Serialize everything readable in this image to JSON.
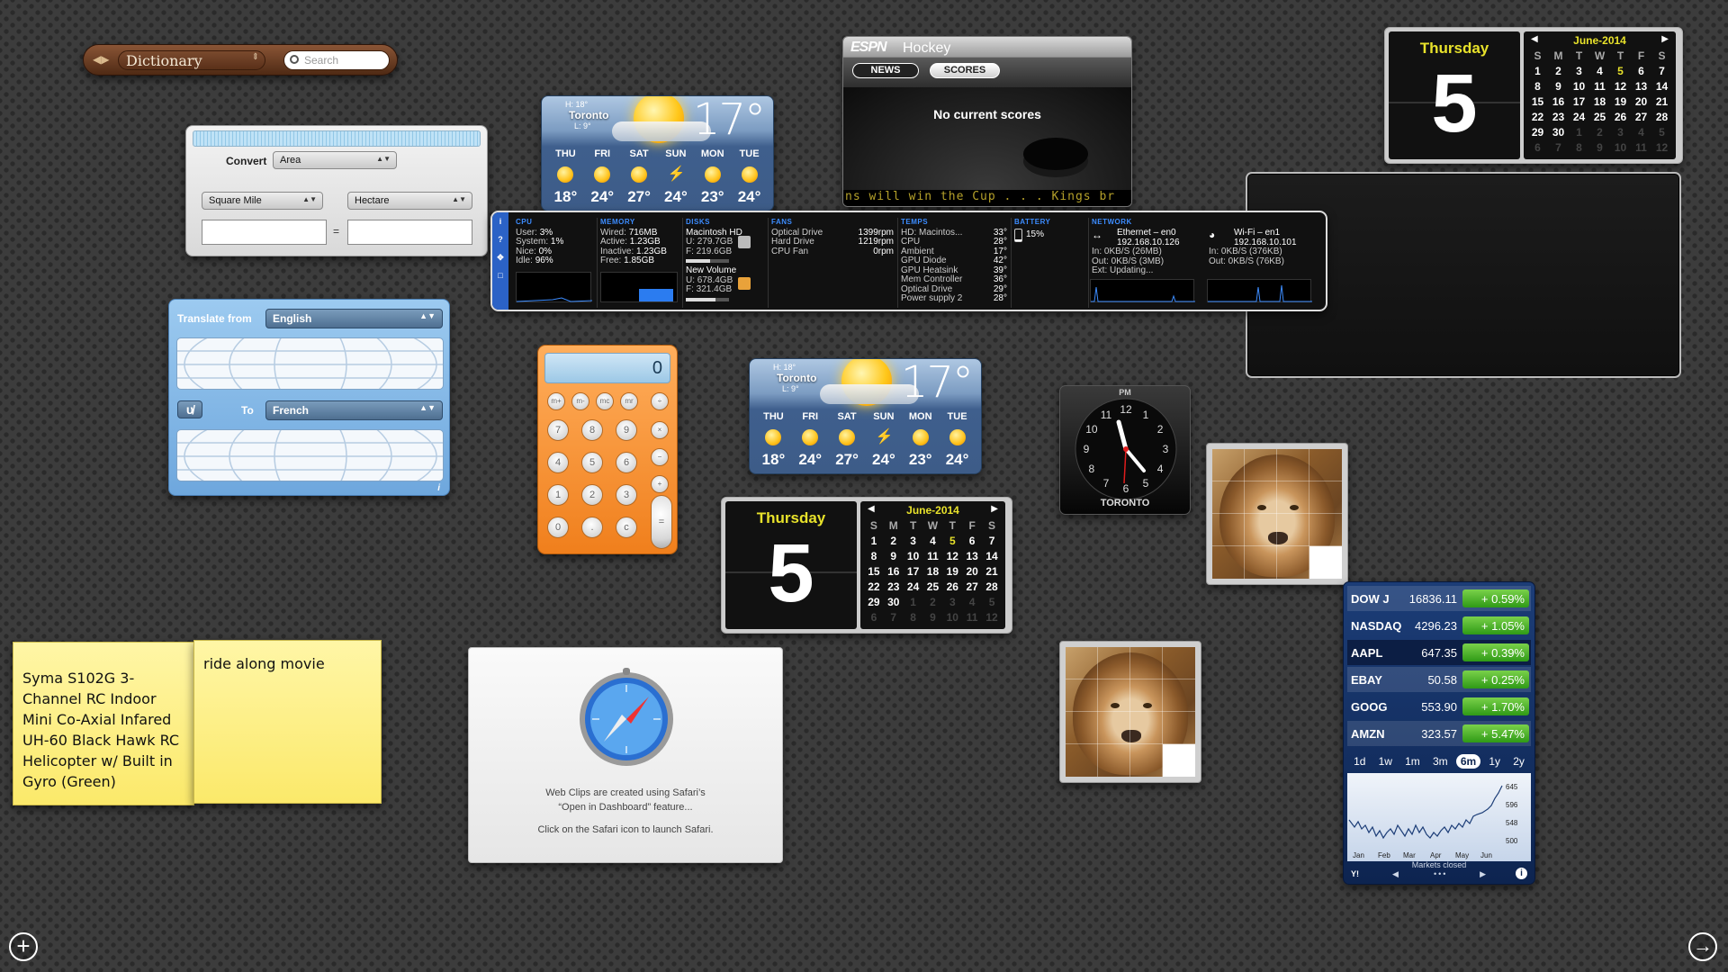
{
  "dictionary": {
    "selected": "Dictionary",
    "search_placeholder": "Search"
  },
  "converter": {
    "convert_label": "Convert",
    "category": "Area",
    "from_unit": "Square Mile",
    "to_unit": "Hectare",
    "equals": "="
  },
  "translator": {
    "from_label": "Translate from",
    "from_lang": "English",
    "to_label": "To",
    "to_lang": "French",
    "swap_glyph": "υ̸",
    "info": "i"
  },
  "weather_top": {
    "hi": "H: 18°",
    "city": "Toronto",
    "lo": "L: 9°",
    "temp": "17°",
    "days": [
      {
        "name": "THU",
        "temp": "18°",
        "icon": "sun-icon"
      },
      {
        "name": "FRI",
        "temp": "24°",
        "icon": "partly-cloudy-icon"
      },
      {
        "name": "SAT",
        "temp": "27°",
        "icon": "sun-icon"
      },
      {
        "name": "SUN",
        "temp": "24°",
        "icon": "thunderstorm-icon"
      },
      {
        "name": "MON",
        "temp": "23°",
        "icon": "partly-cloudy-icon"
      },
      {
        "name": "TUE",
        "temp": "24°",
        "icon": "partly-cloudy-icon"
      }
    ]
  },
  "weather_mid": {
    "hi": "H: 18°",
    "city": "Toronto",
    "lo": "L: 9°",
    "temp": "17°",
    "days": [
      {
        "name": "THU",
        "temp": "18°",
        "icon": "sun-icon"
      },
      {
        "name": "FRI",
        "temp": "24°",
        "icon": "partly-cloudy-icon"
      },
      {
        "name": "SAT",
        "temp": "27°",
        "icon": "sun-icon"
      },
      {
        "name": "SUN",
        "temp": "24°",
        "icon": "thunderstorm-icon"
      },
      {
        "name": "MON",
        "temp": "23°",
        "icon": "partly-cloudy-icon"
      },
      {
        "name": "TUE",
        "temp": "24°",
        "icon": "partly-cloudy-icon"
      }
    ]
  },
  "espn": {
    "logo": "ESPN",
    "title": "Hockey",
    "tab_news": "NEWS",
    "tab_scores": "SCORES",
    "message": "No current scores",
    "ticker": "ns will win the Cup . . . Kings br"
  },
  "calendar": {
    "day_name": "Thursday",
    "day_number": "5",
    "month": "June-2014",
    "weekdays": [
      "S",
      "M",
      "T",
      "W",
      "T",
      "F",
      "S"
    ],
    "weeks": [
      [
        "1",
        "2",
        "3",
        "4",
        "5",
        "6",
        "7"
      ],
      [
        "8",
        "9",
        "10",
        "11",
        "12",
        "13",
        "14"
      ],
      [
        "15",
        "16",
        "17",
        "18",
        "19",
        "20",
        "21"
      ],
      [
        "22",
        "23",
        "24",
        "25",
        "26",
        "27",
        "28"
      ],
      [
        "29",
        "30",
        "1",
        "2",
        "3",
        "4",
        "5"
      ],
      [
        "6",
        "7",
        "8",
        "9",
        "10",
        "11",
        "12"
      ]
    ]
  },
  "istat": {
    "side": [
      "i",
      "?",
      "✥",
      "□"
    ],
    "cpu": {
      "h": "CPU",
      "rows": [
        [
          "User:",
          "3%"
        ],
        [
          "System:",
          "1%"
        ],
        [
          "Nice:",
          "0%"
        ],
        [
          "Idle:",
          "96%"
        ]
      ]
    },
    "memory": {
      "h": "MEMORY",
      "rows": [
        [
          "Wired:",
          "716MB"
        ],
        [
          "Active:",
          "1.23GB"
        ],
        [
          "Inactive:",
          "1.23GB"
        ],
        [
          "Free:",
          "1.85GB"
        ]
      ]
    },
    "disks": {
      "h": "DISKS",
      "d1": "Macintosh HD",
      "d1u": "U: 279.7GB",
      "d1f": "F: 219.6GB",
      "d2": "New Volume",
      "d2u": "U: 678.4GB",
      "d2f": "F: 321.4GB"
    },
    "fans": {
      "h": "FANS",
      "rows": [
        [
          "Optical Drive",
          "1399rpm"
        ],
        [
          "Hard Drive",
          "1219rpm"
        ],
        [
          "CPU Fan",
          "0rpm"
        ]
      ]
    },
    "temps": {
      "h": "TEMPS",
      "rows": [
        [
          "HD: Macintos...",
          "33°"
        ],
        [
          "CPU",
          "28°"
        ],
        [
          "Ambient",
          "17°"
        ],
        [
          "GPU Diode",
          "42°"
        ],
        [
          "GPU Heatsink",
          "39°"
        ],
        [
          "Mem Controller",
          "36°"
        ],
        [
          "Optical Drive",
          "29°"
        ],
        [
          "Power supply 2",
          "28°"
        ]
      ]
    },
    "battery": {
      "h": "BATTERY",
      "pct": "15%"
    },
    "network": {
      "h": "NETWORK",
      "eth_name": "Ethernet – en0",
      "eth_ip": "192.168.10.126",
      "eth_in": "In: 0KB/S (26MB)",
      "eth_out": "Out: 0KB/S (3MB)",
      "eth_ext": "Ext: Updating...",
      "wifi_name": "Wi-Fi – en1",
      "wifi_ip": "192.168.10.101",
      "wifi_in": "In: 0KB/S (376KB)",
      "wifi_out": "Out: 0KB/S (76KB)"
    }
  },
  "calculator": {
    "display": "0",
    "mem_keys": [
      "m+",
      "m-",
      "mc",
      "mr"
    ],
    "rows": [
      [
        "7",
        "8",
        "9"
      ],
      [
        "4",
        "5",
        "6"
      ],
      [
        "1",
        "2",
        "3"
      ],
      [
        "0",
        ".",
        "c"
      ]
    ],
    "ops": [
      "÷",
      "×",
      "−",
      "+",
      "="
    ]
  },
  "clock": {
    "ampm": "PM",
    "city": "TORONTO",
    "numbers": [
      "12",
      "1",
      "2",
      "3",
      "4",
      "5",
      "6",
      "7",
      "8",
      "9",
      "10",
      "11"
    ]
  },
  "sticky1": {
    "text": "Syma S102G 3-Channel RC Indoor Mini Co-Axial Infared UH-60 Black Hawk RC Helicopter w/ Built in Gyro (Green)"
  },
  "sticky2": {
    "text": "ride along movie"
  },
  "webclip": {
    "line1": "Web Clips are created using Safari’s",
    "line2": "“Open in Dashboard” feature...",
    "line3": "Click on the Safari icon to launch Safari."
  },
  "stocks": {
    "rows": [
      {
        "sym": "DOW J",
        "price": "16836.11",
        "change": "+ 0.59%"
      },
      {
        "sym": "NASDAQ",
        "price": "4296.23",
        "change": "+ 1.05%"
      },
      {
        "sym": "AAPL",
        "price": "647.35",
        "change": "+ 0.39%"
      },
      {
        "sym": "EBAY",
        "price": "50.58",
        "change": "+ 0.25%"
      },
      {
        "sym": "GOOG",
        "price": "553.90",
        "change": "+ 1.70%"
      },
      {
        "sym": "AMZN",
        "price": "323.57",
        "change": "+ 5.47%"
      }
    ],
    "ranges": [
      "1d",
      "1w",
      "1m",
      "3m",
      "6m",
      "1y",
      "2y"
    ],
    "active_range": "6m",
    "y_ticks": [
      "645",
      "596",
      "548",
      "500"
    ],
    "months": [
      "Jan",
      "Feb",
      "Mar",
      "Apr",
      "May",
      "Jun"
    ],
    "status": "Markets closed",
    "logo": "Y!"
  },
  "bottom": {
    "add": "+",
    "next": "→"
  }
}
